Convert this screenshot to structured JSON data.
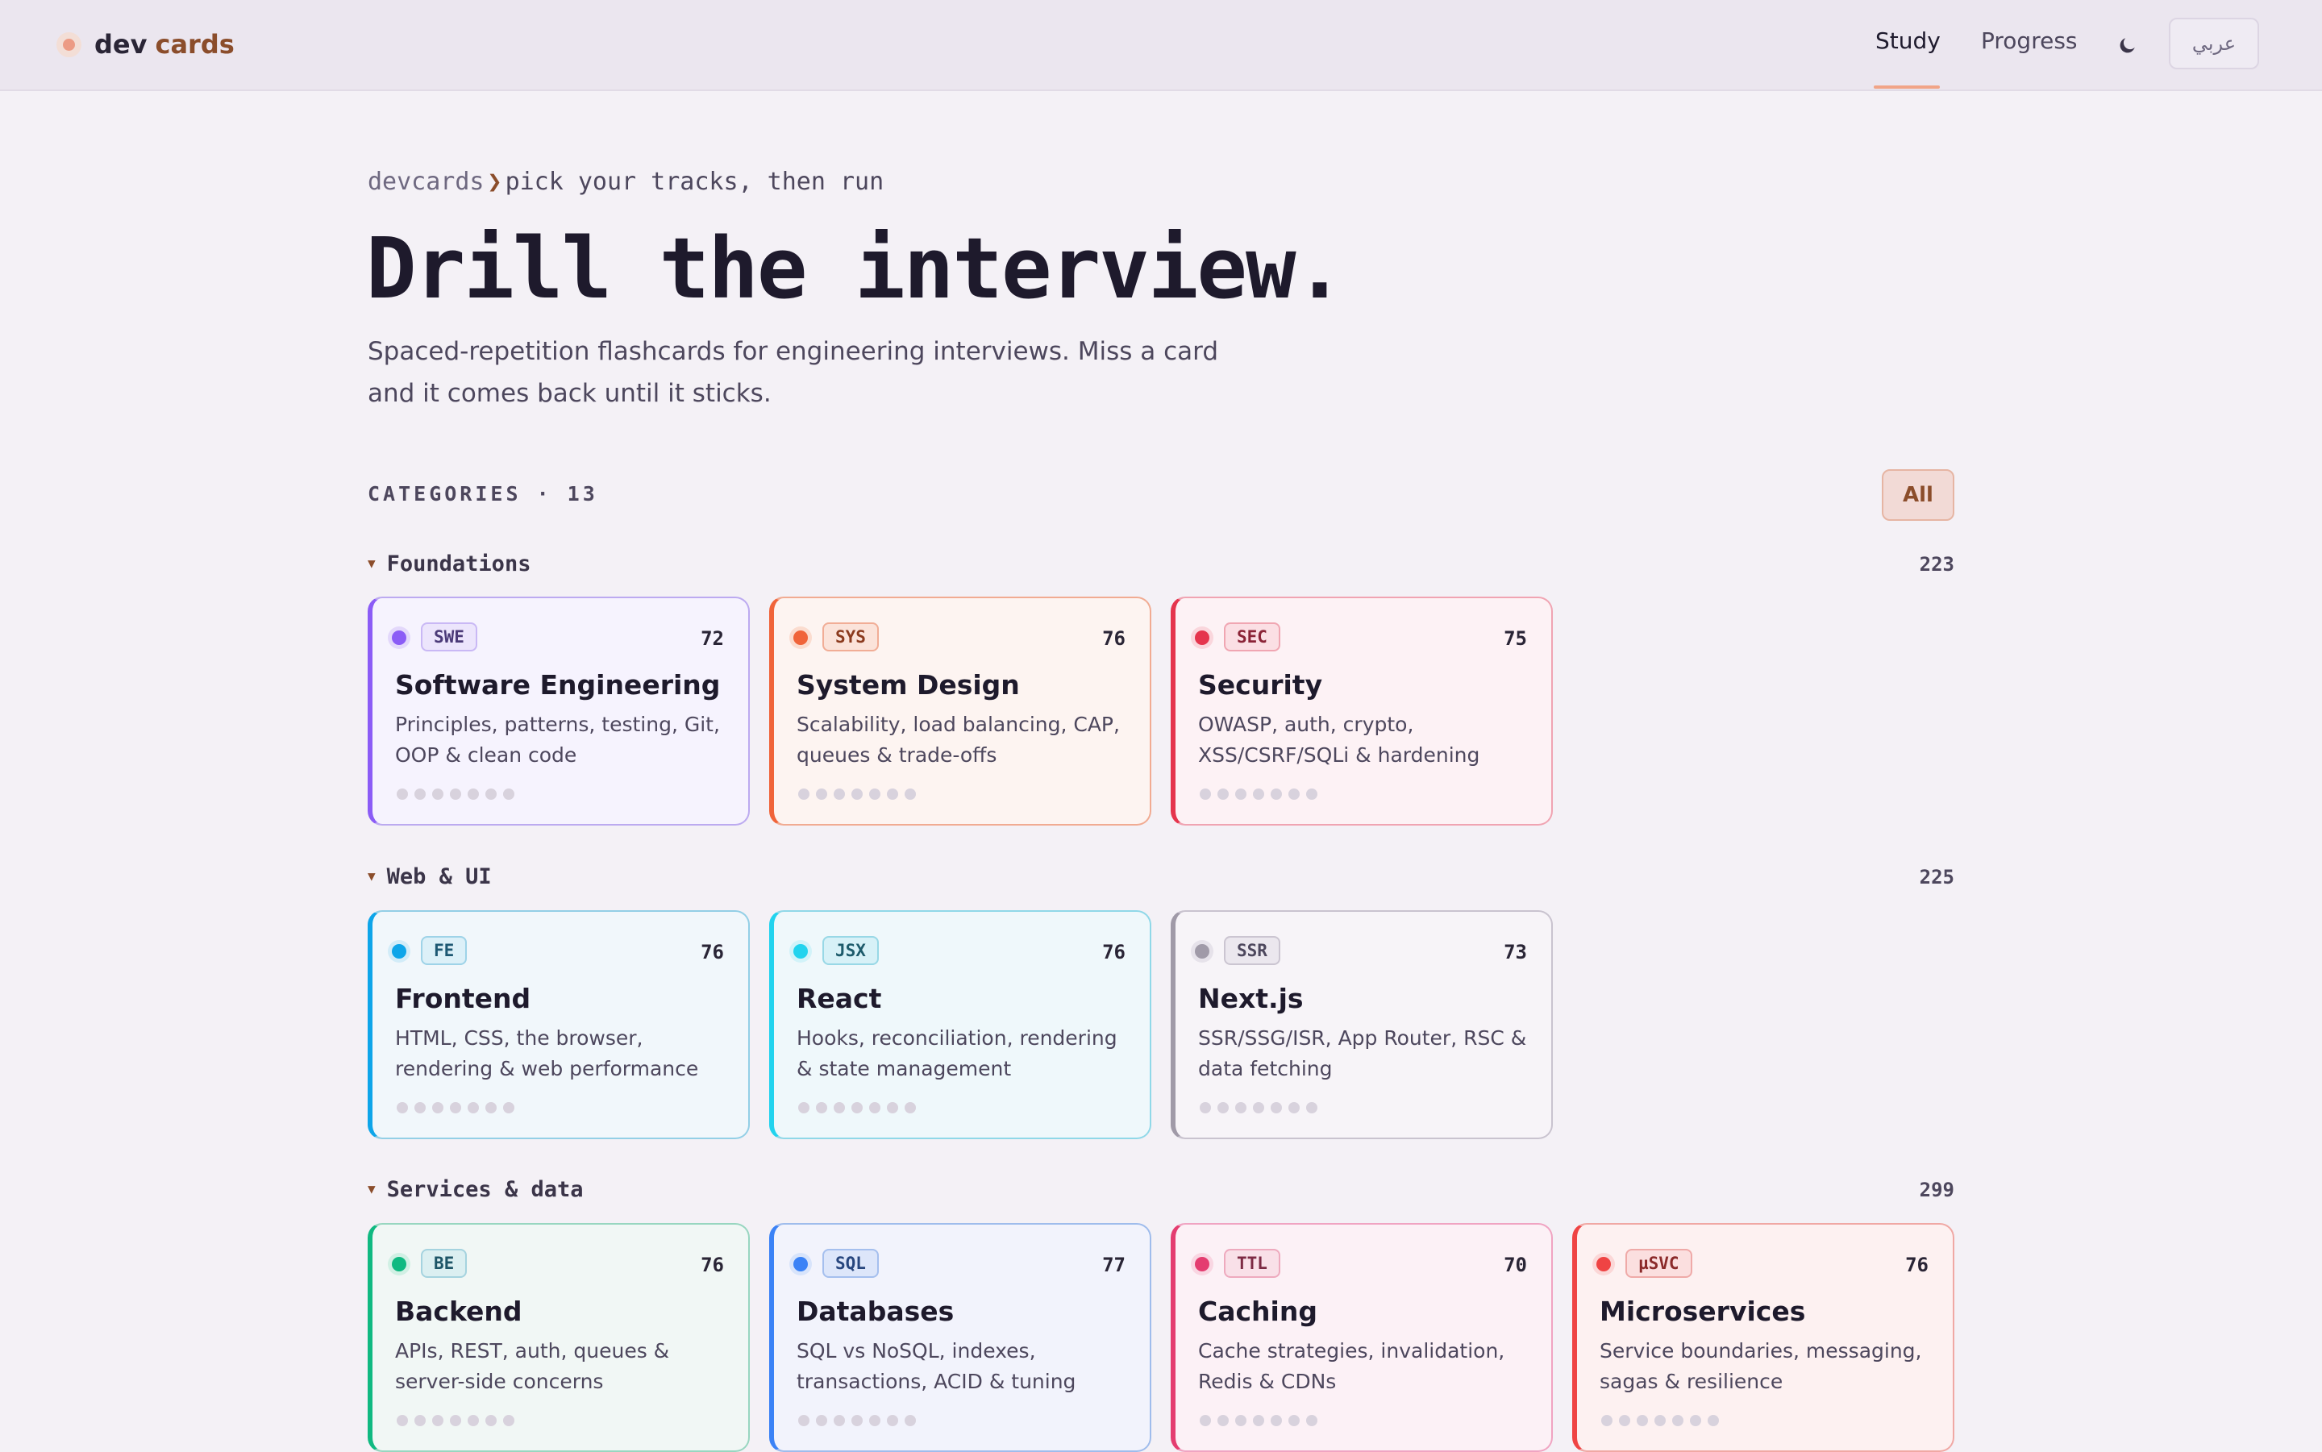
{
  "nav": {
    "brand_a": "dev",
    "brand_b": "cards",
    "study": "Study",
    "progress": "Progress",
    "theme_icon": "moon-icon",
    "lang": "عربي"
  },
  "hero": {
    "crumb_root": "devcards",
    "crumb_sep": "❯",
    "crumb_text": "pick your tracks, then run",
    "title": "Drill the interview.",
    "subtitle": "Spaced-repetition flashcards for engineering interviews. Miss a card and it comes back until it sticks."
  },
  "categories": {
    "label": "CATEGORIES · 13",
    "filter": "All"
  },
  "groups": [
    {
      "name": "Foundations",
      "count": "223",
      "cards": [
        {
          "badge": "SWE",
          "count": "72",
          "title": "Software Engineering",
          "desc": "Principles, patterns, testing, Git, OOP & clean code",
          "accent": "#8b5cf6"
        },
        {
          "badge": "SYS",
          "count": "76",
          "title": "System Design",
          "desc": "Scalability, load balancing, CAP, queues & trade-offs",
          "accent": "#f0643a"
        },
        {
          "badge": "SEC",
          "count": "75",
          "title": "Security",
          "desc": "OWASP, auth, crypto, XSS/CSRF/SQLi & hardening",
          "accent": "#e5354d"
        }
      ]
    },
    {
      "name": "Web & UI",
      "count": "225",
      "cards": [
        {
          "badge": "FE",
          "count": "76",
          "title": "Frontend",
          "desc": "HTML, CSS, the browser, rendering & web performance",
          "accent": "#0ea5e9"
        },
        {
          "badge": "JSX",
          "count": "76",
          "title": "React",
          "desc": "Hooks, reconciliation, rendering & state management",
          "accent": "#22d3ee"
        },
        {
          "badge": "SSR",
          "count": "73",
          "title": "Next.js",
          "desc": "SSR/SSG/ISR, App Router, RSC & data fetching",
          "accent": "#a09aa8"
        }
      ]
    },
    {
      "name": "Services & data",
      "count": "299",
      "cards": [
        {
          "badge": "BE",
          "count": "76",
          "title": "Backend",
          "desc": "APIs, REST, auth, queues & server-side concerns",
          "accent": "#10b981"
        },
        {
          "badge": "SQL",
          "count": "77",
          "title": "Databases",
          "desc": "SQL vs NoSQL, indexes, transactions, ACID & tuning",
          "accent": "#3b82f6"
        },
        {
          "badge": "TTL",
          "count": "70",
          "title": "Caching",
          "desc": "Cache strategies, invalidation, Redis & CDNs",
          "accent": "#e43d70"
        },
        {
          "badge": "µSVC",
          "count": "76",
          "title": "Microservices",
          "desc": "Service boundaries, messaging, sagas & resilience",
          "accent": "#ef4444"
        }
      ]
    }
  ]
}
